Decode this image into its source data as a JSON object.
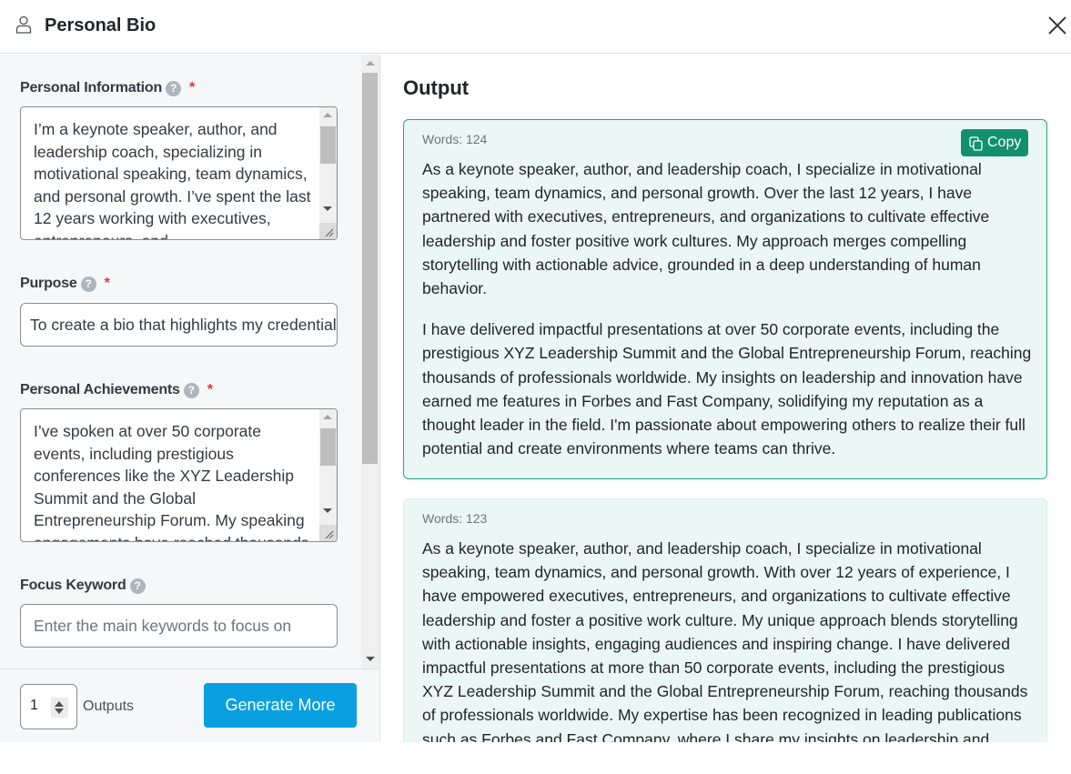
{
  "header": {
    "title": "Personal Bio",
    "icon": "user-icon",
    "close_icon": "close-icon"
  },
  "form": {
    "personal_information": {
      "label": "Personal Information",
      "required": "*",
      "help": "?",
      "value": "I’m a keynote speaker, author, and leadership coach, specializing in motivational speaking, team dynamics, and personal growth. I’ve spent the last 12 years working with executives, entrepreneurs, and"
    },
    "purpose": {
      "label": "Purpose",
      "required": "*",
      "help": "?",
      "value": "To create a bio that highlights my credentials"
    },
    "personal_achievements": {
      "label": "Personal Achievements",
      "required": "*",
      "help": "?",
      "value": "I’ve spoken at over 50 corporate events, including prestigious conferences like the XYZ Leadership Summit and the Global Entrepreneurship Forum. My speaking engagements have reached thousands"
    },
    "focus_keyword": {
      "label": "Focus Keyword",
      "help": "?",
      "value": "",
      "placeholder": "Enter the main keywords to focus on"
    }
  },
  "footer": {
    "outputs_count": "1",
    "outputs_label": "Outputs",
    "generate_button": "Generate More"
  },
  "output": {
    "title": "Output",
    "copy_label": "Copy",
    "cards": [
      {
        "words": "Words: 124",
        "paragraphs": [
          "As a keynote speaker, author, and leadership coach, I specialize in motivational speaking, team dynamics, and personal growth. Over the last 12 years, I have partnered with executives, entrepreneurs, and organizations to cultivate effective leadership and foster positive work cultures. My approach merges compelling storytelling with actionable advice, grounded in a deep understanding of human behavior.",
          "I have delivered impactful presentations at over 50 corporate events, including the prestigious XYZ Leadership Summit and the Global Entrepreneurship Forum, reaching thousands of professionals worldwide. My insights on leadership and innovation have earned me features in Forbes and Fast Company, solidifying my reputation as a thought leader in the field. I'm passionate about empowering others to realize their full potential and create environments where teams can thrive."
        ]
      },
      {
        "words": "Words: 123",
        "paragraphs": [
          "As a keynote speaker, author, and leadership coach, I specialize in motivational speaking, team dynamics, and personal growth. With over 12 years of experience, I have empowered executives, entrepreneurs, and organizations to cultivate effective leadership and foster a positive work culture. My unique approach blends storytelling with actionable insights, engaging audiences and inspiring change. I have delivered impactful presentations at more than 50 corporate events, including the prestigious XYZ Leadership Summit and the Global Entrepreneurship Forum, reaching thousands of professionals worldwide. My expertise has been recognized in leading publications such as Forbes and Fast Company, where I share my insights on leadership and"
        ]
      }
    ]
  },
  "colors": {
    "primary_button": "#0a9fe0",
    "copy_button": "#12906e",
    "card_border_active": "#20a884",
    "card_background": "#ebf7f5",
    "required_star": "#dc3545"
  }
}
